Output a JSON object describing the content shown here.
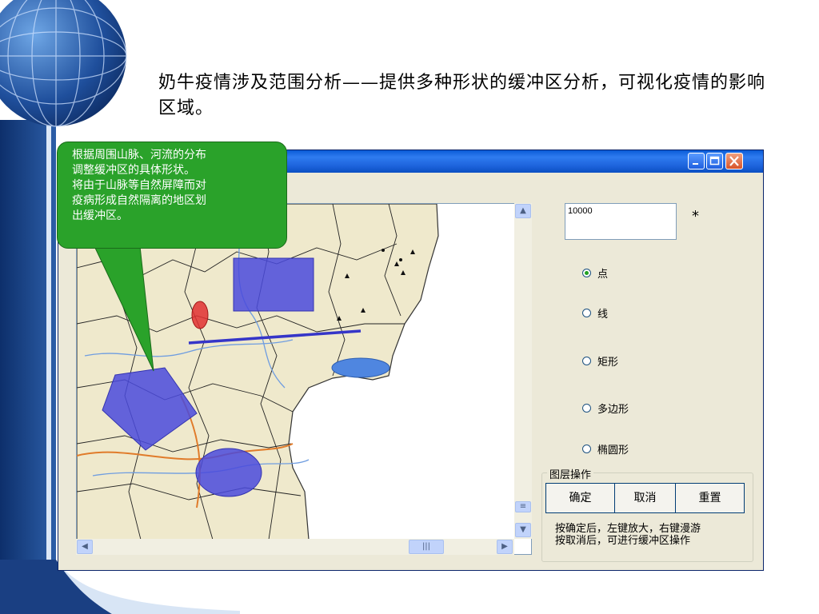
{
  "slide": {
    "title": "奶牛疫情涉及范围分析——提供多种形状的缓冲区分析，可视化疫情的影响区域。"
  },
  "callout": {
    "lines": [
      "根据周围山脉、河流的分布",
      "调整缓冲区的具体形状。",
      "将由于山脉等自然屏障而对",
      "疫病形成自然隔离的地区划",
      "出缓冲区。"
    ]
  },
  "window": {
    "buffer_value": "10000",
    "asterisk": "*",
    "shape_options": [
      {
        "label": "点",
        "selected": true
      },
      {
        "label": "线",
        "selected": false
      },
      {
        "label": "矩形",
        "selected": false
      },
      {
        "label": "多边形",
        "selected": false
      },
      {
        "label": "椭圆形",
        "selected": false
      }
    ],
    "layer_group": {
      "title": "图层操作",
      "buttons": [
        "确定",
        "取消",
        "重置"
      ],
      "hint_lines": [
        "按确定后，左键放大，右键漫游",
        "按取消后，可进行缓冲区操作"
      ]
    }
  },
  "colors": {
    "callout_green": "#2aa22a",
    "buffer_blue": "#4a4adc",
    "buffer_red": "#e03030",
    "titlebar_blue": "#1d63dc",
    "window_bg": "#ece9d8"
  }
}
